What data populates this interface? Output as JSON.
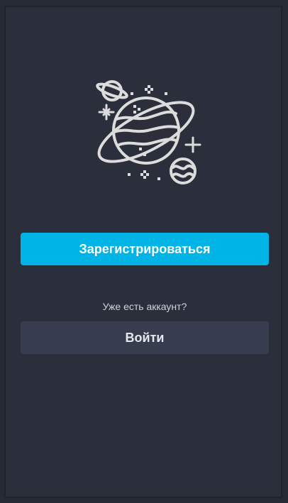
{
  "illustration": {
    "icon": "planet-illustration-icon",
    "color": "#dcdcdc"
  },
  "register_button": {
    "label": "Зарегистрироваться",
    "color": "#00b4e6"
  },
  "login_prompt": "Уже есть аккаунт?",
  "login_button": {
    "label": "Войти",
    "color": "#383c4f"
  },
  "colors": {
    "background": "#2b2f3b",
    "outer": "#252a34"
  }
}
